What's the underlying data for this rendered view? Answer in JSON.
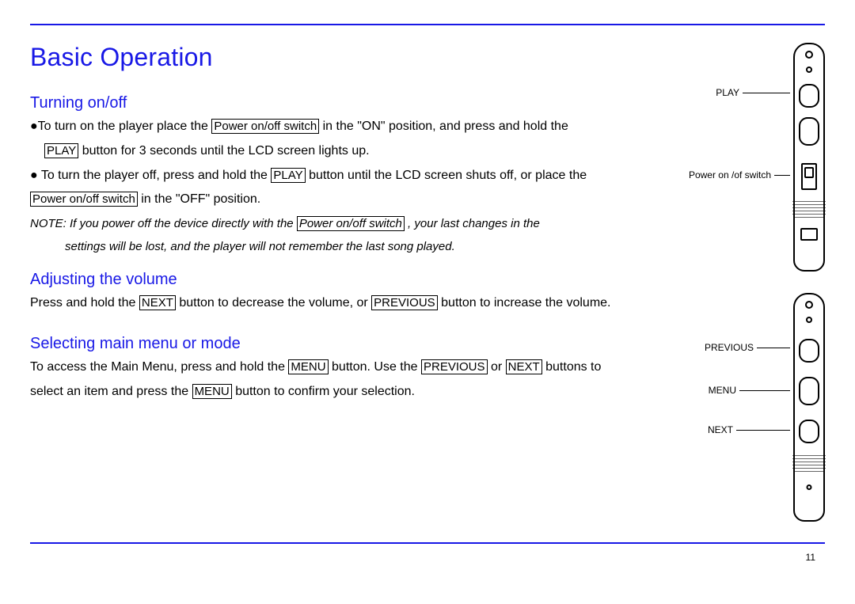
{
  "page_number": "11",
  "title": "Basic Operation",
  "sections": {
    "turning": {
      "heading": "Turning on/off",
      "p1_pre": "●To turn on the player place the ",
      "p1_box1": "Power on/off switch",
      "p1_mid": " in the \"ON\" position, and press and hold the",
      "p1_line2_box": "PLAY",
      "p1_line2_tail": " button for 3 seconds until the LCD screen lights up.",
      "p2_pre": "● To turn the player off, press and hold the ",
      "p2_box1": "PLAY",
      "p2_mid": " button until the LCD screen shuts off, or place the",
      "p2_line2_box": "Power on/off switch",
      "p2_line2_tail": " in the \"OFF\" position.",
      "note_pre": "NOTE: If you power off the device directly with the ",
      "note_box": "Power on/off switch",
      "note_tail": ", your last changes in the",
      "note_line2": "settings will be lost, and the player will not remember the last song played."
    },
    "volume": {
      "heading": "Adjusting the volume",
      "p_pre": "Press and hold the ",
      "p_box1": "NEXT",
      "p_mid": " button to decrease the volume, or ",
      "p_box2": "PREVIOUS",
      "p_tail": " button to increase the volume."
    },
    "menu": {
      "heading": "Selecting main menu or mode",
      "p_pre": "To access the Main Menu, press and hold the ",
      "p_box1": "MENU",
      "p_mid": " button.  Use the ",
      "p_box2": "PREVIOUS",
      "p_mid2": " or ",
      "p_box3": "NEXT",
      "p_tail": " buttons to",
      "p_line2_pre": "select an item and press the ",
      "p_line2_box": "MENU",
      "p_line2_tail": " button to confirm your selection."
    }
  },
  "diagram": {
    "top": {
      "play": "PLAY",
      "power_switch": "Power on /of switch"
    },
    "bottom": {
      "previous": "PREVIOUS",
      "menu": "MENU",
      "next": "NEXT"
    }
  }
}
